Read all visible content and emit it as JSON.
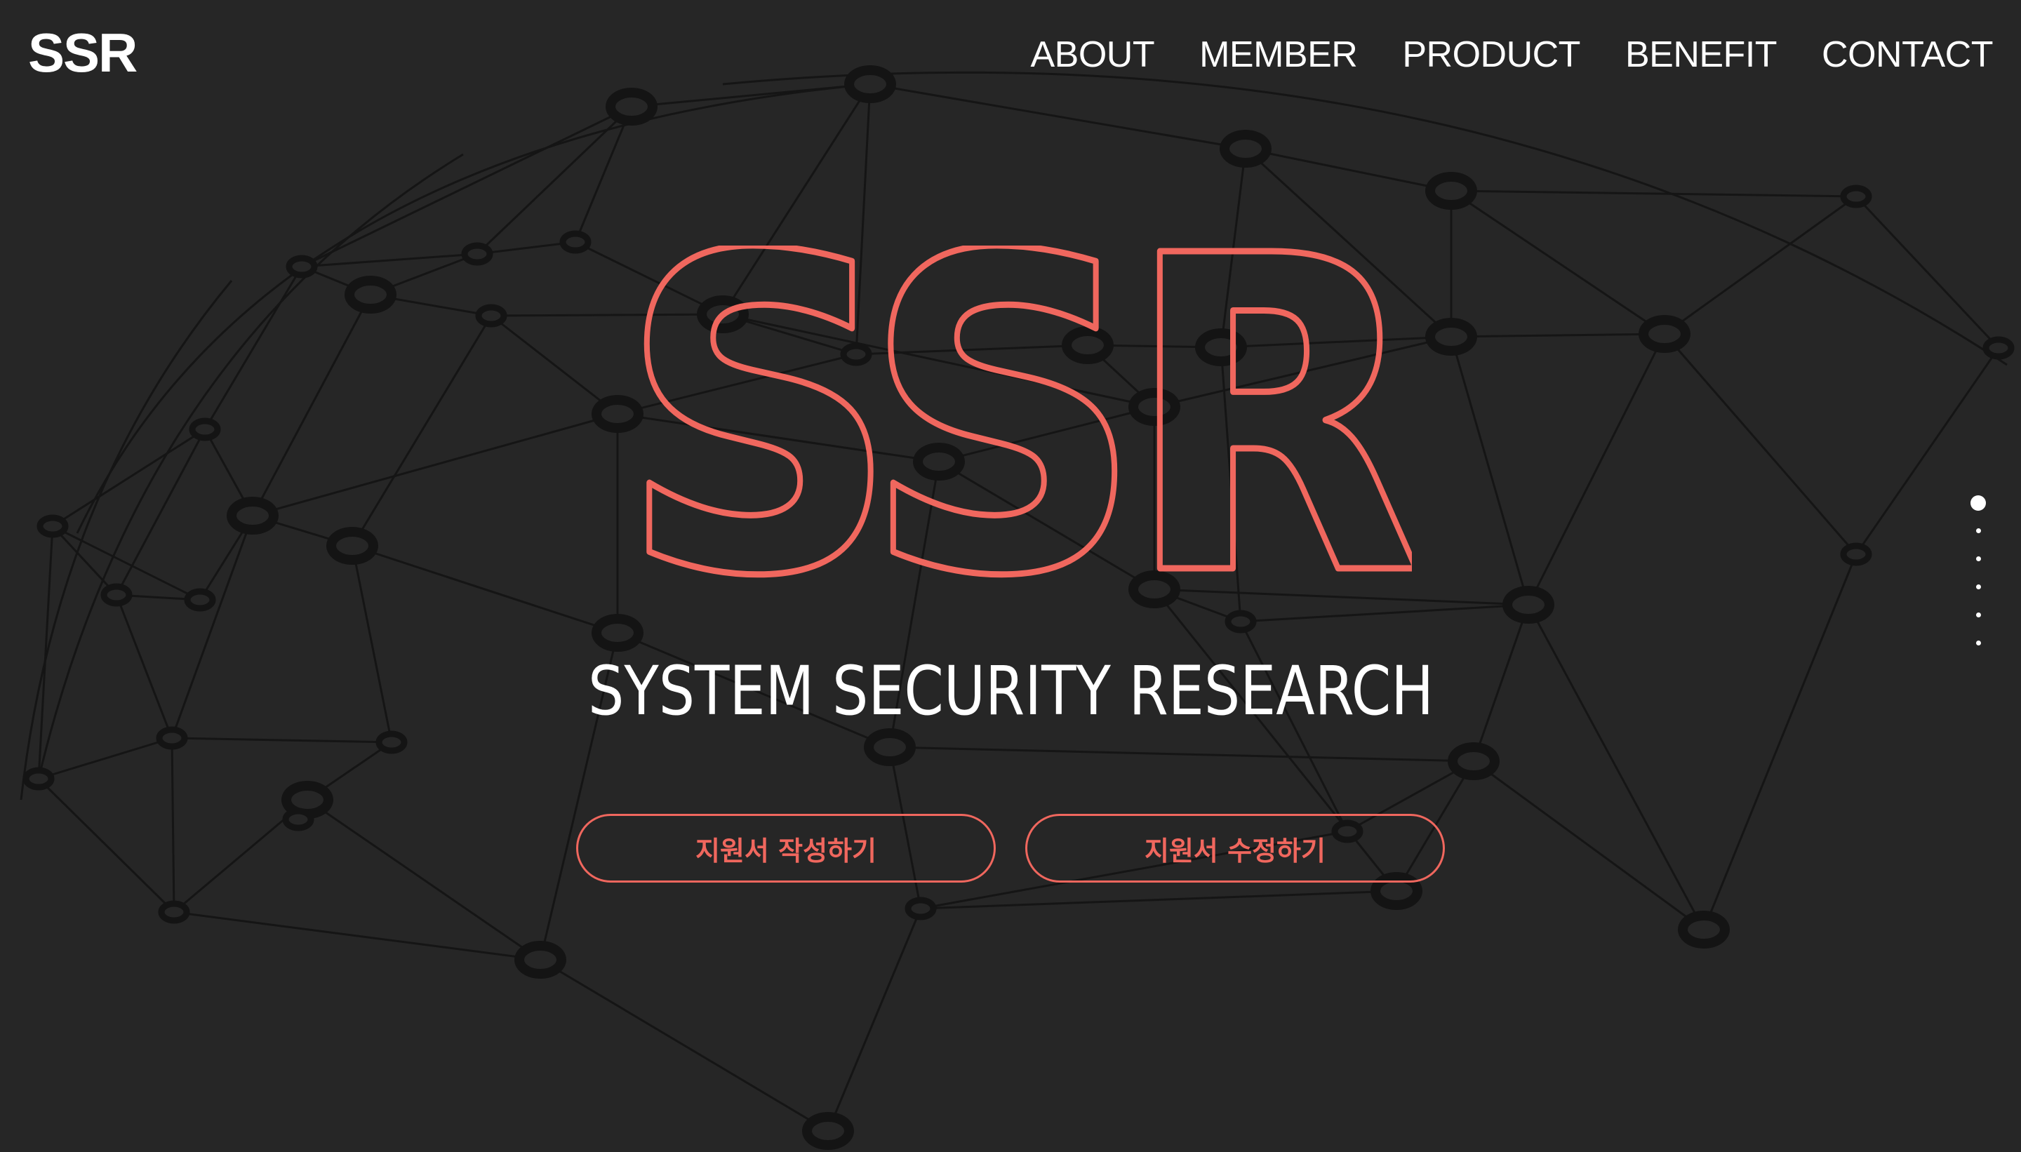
{
  "header": {
    "logo": "SSR",
    "nav": [
      {
        "label": "ABOUT"
      },
      {
        "label": "MEMBER"
      },
      {
        "label": "PRODUCT"
      },
      {
        "label": "BENEFIT"
      },
      {
        "label": "CONTACT"
      }
    ]
  },
  "hero": {
    "logo_text": "SSR",
    "subtitle": "SYSTEM SECURITY RESEARCH",
    "buttons": {
      "write_application": "지원서 작성하기",
      "edit_application": "지원서 수정하기"
    }
  },
  "pagination": {
    "total": 6,
    "active": 1
  },
  "colors": {
    "background": "#262626",
    "accent": "#f0675e",
    "network_lines": "#151515",
    "text": "#ffffff"
  }
}
